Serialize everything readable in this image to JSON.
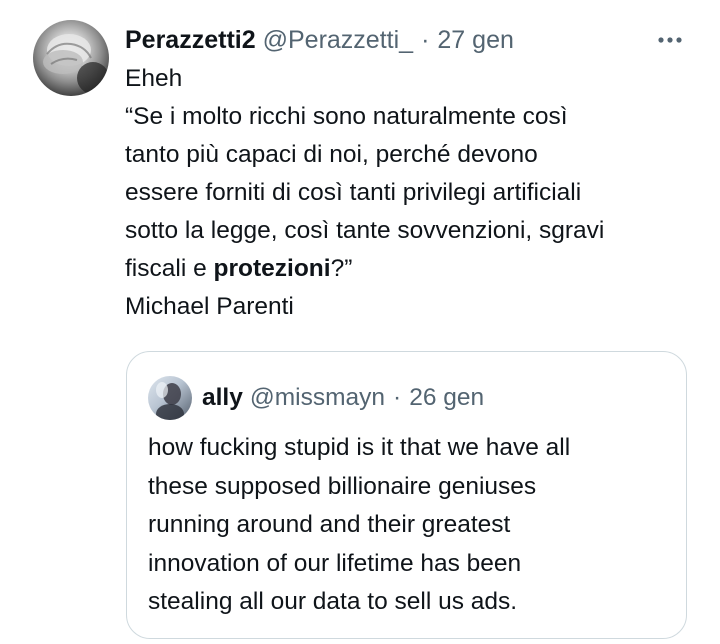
{
  "tweet": {
    "author": {
      "display_name": "Perazzetti2",
      "handle": "@Perazzetti_",
      "separator": "·",
      "date": "27 gen"
    },
    "text_lines": [
      "Eheh",
      "“Se i molto ricchi sono naturalmente così",
      "tanto più capaci di noi, perché devono",
      "essere forniti di così tanti privilegi artificiali",
      "sotto la legge, così tante sovvenzioni, sgravi"
    ],
    "text_line6": {
      "before": "fiscali e ",
      "bold": "protezioni",
      "after": "?”"
    },
    "signature": "Michael Parenti",
    "more_icon": "more-horizontal-icon"
  },
  "quote": {
    "author": {
      "display_name": "ally",
      "handle": "@missmayn",
      "separator": "·",
      "date": "26 gen"
    },
    "text_lines": [
      "how fucking stupid is it that we have all",
      "these supposed billionaire geniuses",
      "running around and their greatest",
      "innovation of our lifetime has been",
      "stealing all our data to sell us ads."
    ]
  },
  "colors": {
    "text_primary": "#0f1419",
    "text_secondary": "#536471",
    "border": "#cfd9de",
    "background": "#ffffff"
  }
}
